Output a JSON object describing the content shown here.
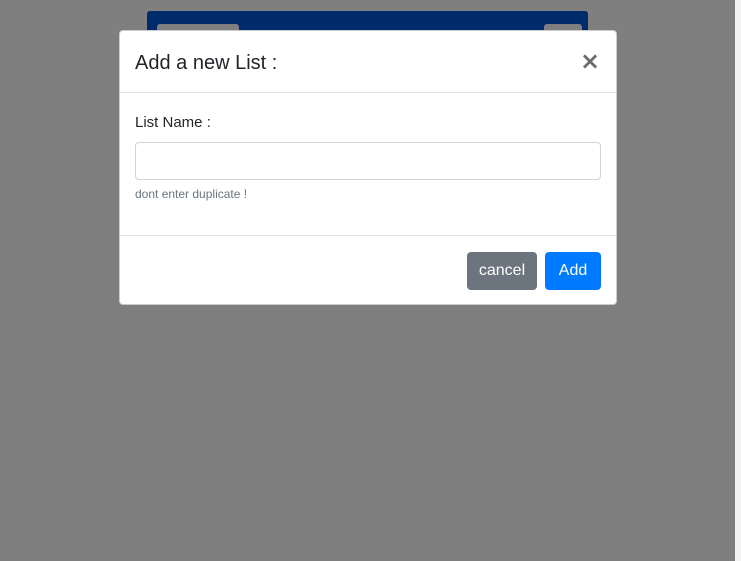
{
  "modal": {
    "title": "Add a new List :",
    "close_symbol": "×",
    "field_label": "List Name :",
    "input_value": "",
    "input_placeholder": "",
    "help_text": "dont enter duplicate !",
    "cancel_label": "cancel",
    "add_label": "Add"
  },
  "colors": {
    "navbar": "#0056d6",
    "cancel_button": "#6c757d",
    "add_button": "#007bff",
    "backdrop": "rgba(0,0,0,0.5)"
  },
  "icons": {
    "close": "close-icon"
  }
}
